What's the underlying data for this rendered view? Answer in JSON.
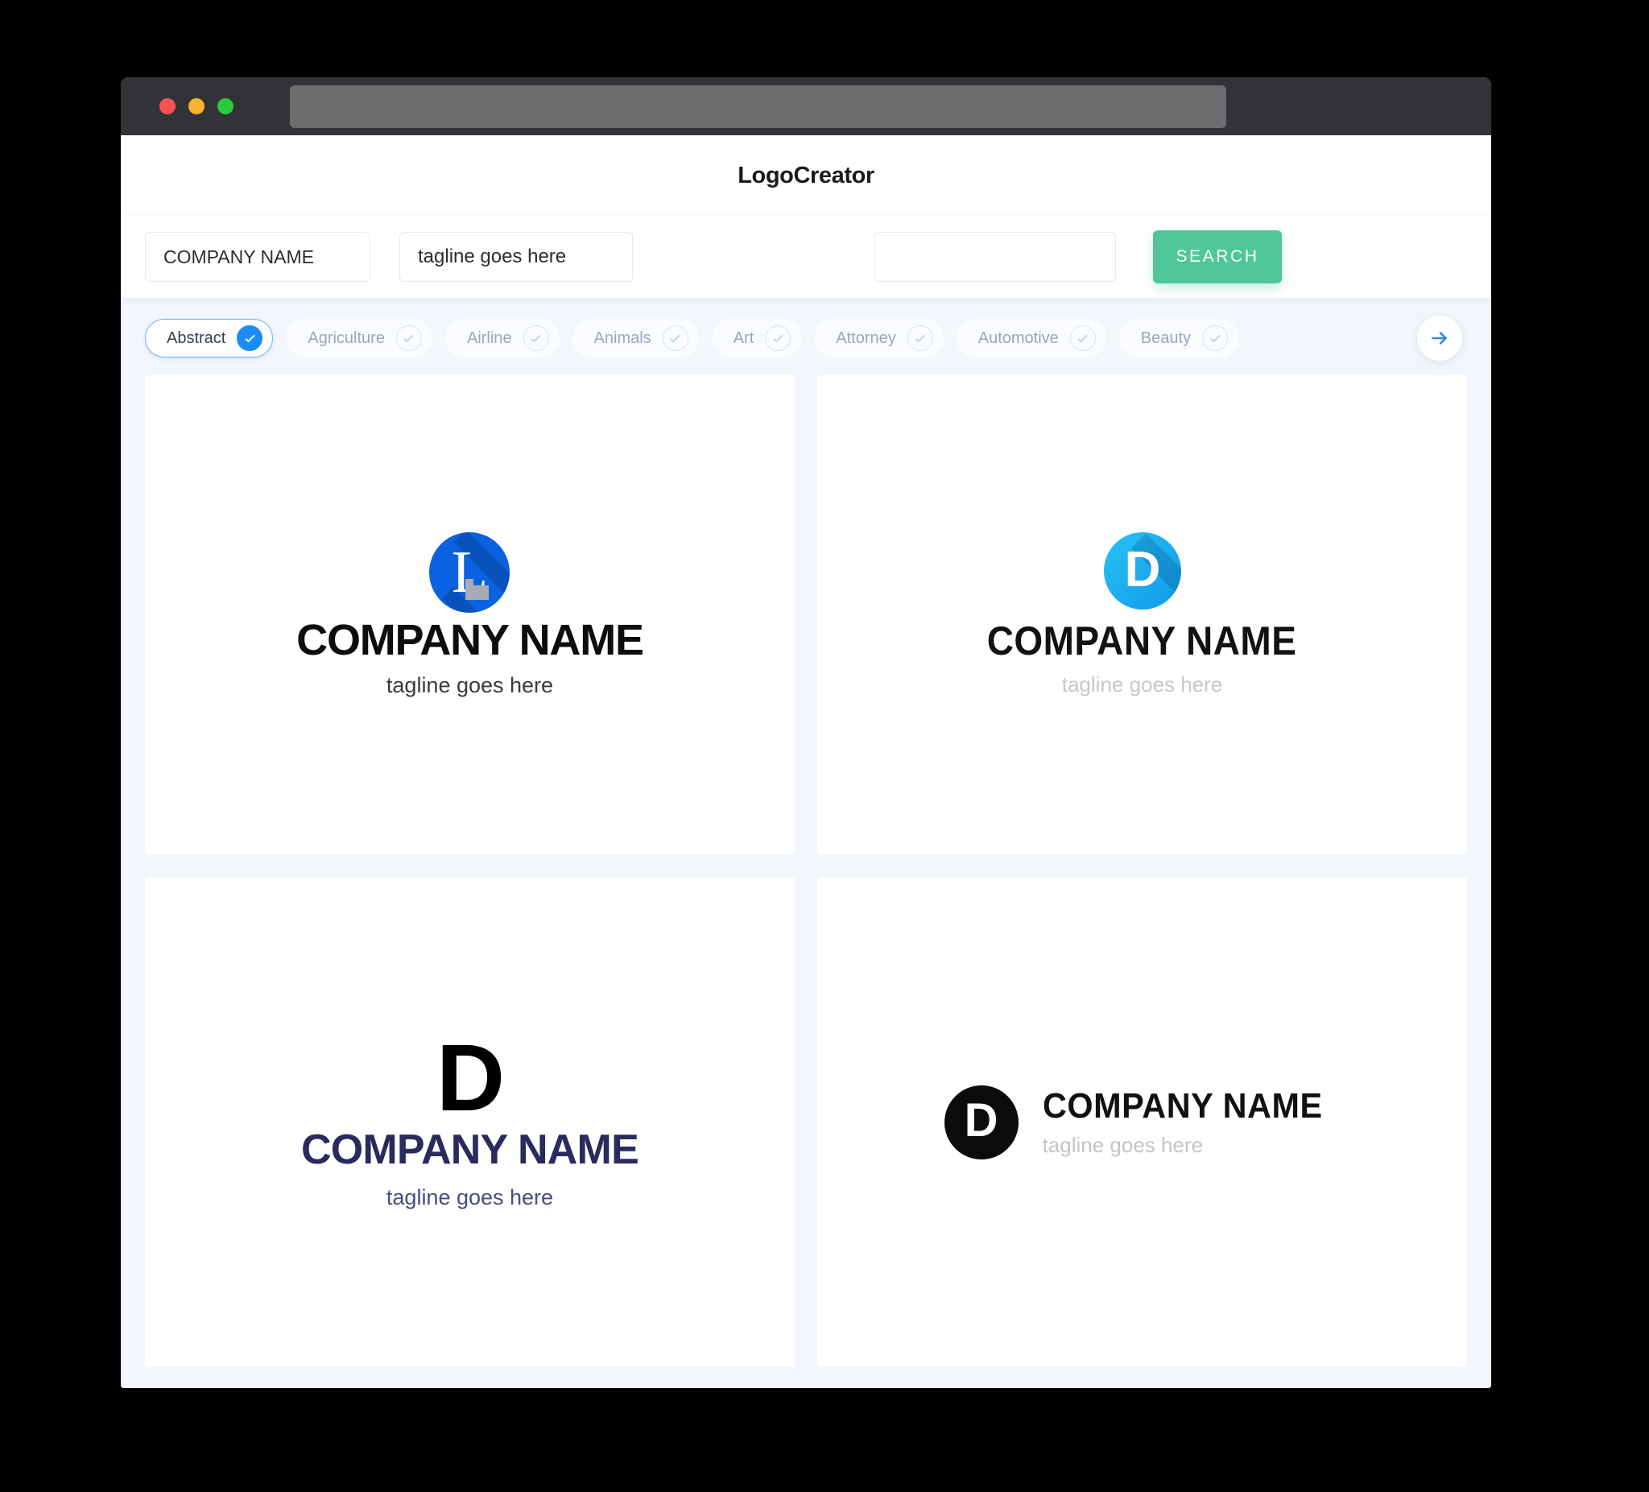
{
  "browser": {
    "traffic_lights": [
      "close-red",
      "minimize-yellow",
      "maximize-green"
    ],
    "url_value": ""
  },
  "app": {
    "title": "LogoCreator"
  },
  "search": {
    "company_value": "COMPANY NAME",
    "company_placeholder": "COMPANY NAME",
    "tagline_value": "tagline goes here",
    "tagline_placeholder": "tagline goes here",
    "extra_value": "",
    "extra_placeholder": "",
    "button_label": "SEARCH",
    "button_color": "#4fc79a"
  },
  "categories": {
    "next_arrow_icon": "arrow-right-icon",
    "accent_color": "#1b8cf5",
    "items": [
      {
        "label": "Abstract",
        "selected": true
      },
      {
        "label": "Agriculture",
        "selected": false
      },
      {
        "label": "Airline",
        "selected": false
      },
      {
        "label": "Animals",
        "selected": false
      },
      {
        "label": "Art",
        "selected": false
      },
      {
        "label": "Attorney",
        "selected": false
      },
      {
        "label": "Automotive",
        "selected": false
      },
      {
        "label": "Beauty",
        "selected": false
      }
    ]
  },
  "logos": [
    {
      "mark_letter": "L",
      "mark_style": "blue-circle-long-shadow",
      "mark_color": "#0a62e0",
      "name": "COMPANY NAME",
      "tagline": "tagline goes here",
      "name_color": "#0d0d0d",
      "tagline_color": "#3a3a3a"
    },
    {
      "mark_letter": "D",
      "mark_style": "cyan-circle-long-shadow",
      "mark_color": "#1aa9ef",
      "name": "COMPANY NAME",
      "tagline": "tagline goes here",
      "name_color": "#121212",
      "tagline_color": "#c7c7c7"
    },
    {
      "mark_letter": "D",
      "mark_style": "black-letter-stacked",
      "mark_color": "#000000",
      "name": "COMPANY NAME",
      "tagline": "tagline goes here",
      "name_color": "#2b2a5e",
      "tagline_color": "#4a4a86"
    },
    {
      "mark_letter": "D",
      "mark_style": "black-circle-horizontal",
      "mark_color": "#0b0b0b",
      "name": "COMPANY NAME",
      "tagline": "tagline goes here",
      "name_color": "#111111",
      "tagline_color": "#c4c4c4"
    }
  ]
}
